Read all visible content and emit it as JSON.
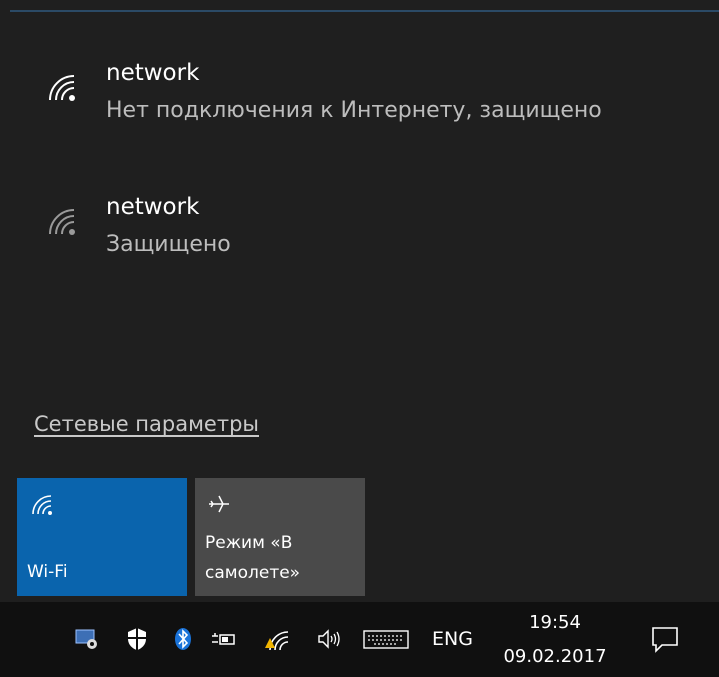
{
  "networks": [
    {
      "name": "network",
      "status": "Нет подключения к Интернету, защищено",
      "icon": "wifi-signal-icon"
    },
    {
      "name": "network",
      "status": "Защищено",
      "icon": "wifi-signal-icon"
    }
  ],
  "settings_link": "Сетевые параметры",
  "tiles": {
    "wifi": {
      "label": "Wi-Fi",
      "icon": "wifi-icon",
      "color": "#0a64ad"
    },
    "airplane": {
      "label": "Режим «В самолете»",
      "icon": "airplane-icon",
      "color": "#4a4a4a"
    }
  },
  "taskbar": {
    "language": "ENG",
    "time": "19:54",
    "date": "09.02.2017",
    "icons": [
      "settings-monitor-icon",
      "defender-shield-icon",
      "bluetooth-icon",
      "power-plug-icon",
      "wifi-warning-icon",
      "speaker-icon",
      "keyboard-icon",
      "action-center-icon"
    ]
  }
}
